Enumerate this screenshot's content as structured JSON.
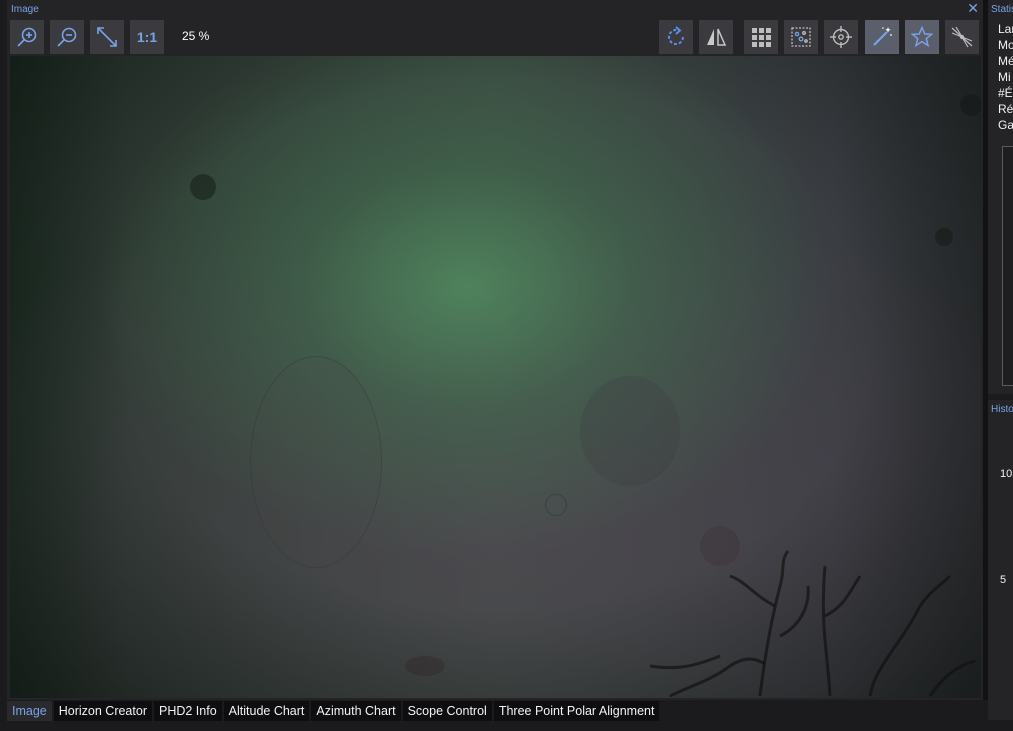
{
  "image_panel": {
    "title": "Image",
    "zoom_level": "25 %",
    "one_to_one_label": "1:1",
    "tools_left": [
      "zoom-in",
      "zoom-out",
      "fit-to-screen",
      "actual-size"
    ],
    "tools_right": [
      "rotate",
      "flip",
      "grid",
      "star-detection",
      "crosshair",
      "auto-stretch",
      "star-annotation",
      "bahtinov"
    ]
  },
  "stats_panel": {
    "title": "Statis",
    "rows": [
      "Lar",
      "Mo",
      "Mé",
      "Mi",
      "#É",
      "Rés",
      "Ga"
    ]
  },
  "hist_panel": {
    "title": "Histo",
    "labels": [
      "10",
      "5"
    ]
  },
  "tabs": [
    {
      "label": "Image",
      "active": true
    },
    {
      "label": "Horizon Creator",
      "active": false
    },
    {
      "label": "PHD2 Info",
      "active": false
    },
    {
      "label": "Altitude Chart",
      "active": false
    },
    {
      "label": "Azimuth Chart",
      "active": false
    },
    {
      "label": "Scope Control",
      "active": false
    },
    {
      "label": "Three Point Polar Alignment",
      "active": false
    }
  ],
  "colors": {
    "accent": "#7aa2e6",
    "panel_bg": "#242427",
    "button_bg": "#3a3a3f"
  }
}
